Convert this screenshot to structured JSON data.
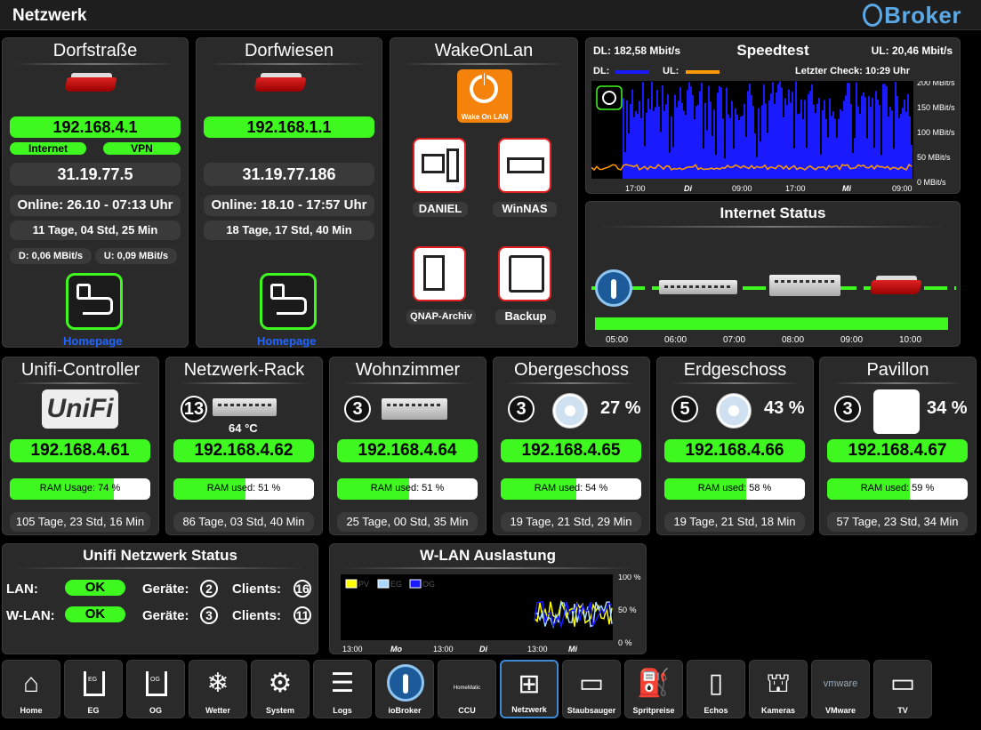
{
  "page_title": "Netzwerk",
  "logo": "Broker",
  "dorf1": {
    "title": "Dorfstraße",
    "ip": "192.168.4.1",
    "badge1": "Internet",
    "badge2": "VPN",
    "ext_ip": "31.19.77.5",
    "online": "Online: 26.10 - 07:13 Uhr",
    "uptime": "11 Tage, 04 Std, 25 Min",
    "down": "D: 0,06 MBit/s",
    "up": "U: 0,09 MBit/s",
    "home": "Homepage"
  },
  "dorf2": {
    "title": "Dorfwiesen",
    "ip": "192.168.1.1",
    "ext_ip": "31.19.77.186",
    "online": "Online: 18.10 - 17:57 Uhr",
    "uptime": "18 Tage, 17 Std, 40 Min",
    "home": "Homepage"
  },
  "wol": {
    "title": "WakeOnLan",
    "logo_text": "Wake On LAN",
    "b1": "DANIEL",
    "b2": "WinNAS",
    "b3": "QNAP-Archiv",
    "b4": "Backup"
  },
  "speedtest": {
    "title": "Speedtest",
    "dl": "DL: 182,58 Mbit/s",
    "ul": "UL: 20,46 Mbit/s",
    "dl_leg": "DL:",
    "ul_leg": "UL:",
    "check": "Letzter Check: 10:29 Uhr",
    "y_ticks": [
      "200 MBit/s",
      "150 MBit/s",
      "100 MBit/s",
      "50 MBit/s",
      "0 MBit/s"
    ],
    "x_ticks": [
      "17:00",
      "Di",
      "09:00",
      "17:00",
      "Mi",
      "09:00"
    ],
    "colors": {
      "dl": "#1a1aff",
      "ul": "#ff9900"
    }
  },
  "inet": {
    "title": "Internet Status",
    "times": [
      "05:00",
      "06:00",
      "07:00",
      "08:00",
      "09:00",
      "10:00"
    ]
  },
  "devices": [
    {
      "title": "Unifi-Controller",
      "logo": "UniFi",
      "ip": "192.168.4.61",
      "ram": "RAM Usage: 74 %",
      "ram_pct": 74,
      "uptime": "105 Tage, 23 Std, 16 Min"
    },
    {
      "title": "Netzwerk-Rack",
      "count": "13",
      "temp": "64 °C",
      "ip": "192.168.4.62",
      "ram": "RAM used: 51 %",
      "ram_pct": 51,
      "uptime": "86 Tage, 03 Std, 40 Min"
    },
    {
      "title": "Wohnzimmer",
      "count": "3",
      "ip": "192.168.4.64",
      "ram": "RAM used: 51 %",
      "ram_pct": 51,
      "uptime": "25 Tage, 00 Std, 35 Min"
    },
    {
      "title": "Obergeschoss",
      "count": "3",
      "pct": "27 %",
      "ip": "192.168.4.65",
      "ram": "RAM used: 54 %",
      "ram_pct": 54,
      "uptime": "19 Tage, 21 Std, 29 Min"
    },
    {
      "title": "Erdgeschoss",
      "count": "5",
      "pct": "43 %",
      "ip": "192.168.4.66",
      "ram": "RAM used: 58 %",
      "ram_pct": 58,
      "uptime": "19 Tage, 21 Std, 18 Min"
    },
    {
      "title": "Pavillon",
      "count": "3",
      "pct": "34 %",
      "ip": "192.168.4.67",
      "ram": "RAM used: 59 %",
      "ram_pct": 59,
      "uptime": "57 Tage, 23 Std, 34 Min"
    }
  ],
  "unifi_status": {
    "title": "Unifi Netzwerk Status",
    "lan": "LAN:",
    "wlan": "W-LAN:",
    "ok": "OK",
    "geraete": "Geräte:",
    "clients": "Clients:",
    "lan_geraete": "2",
    "lan_clients": "16",
    "wlan_geraete": "3",
    "wlan_clients": "11"
  },
  "wlan_load": {
    "title": "W-LAN Auslastung",
    "legend": [
      "PV",
      "EG",
      "OG"
    ],
    "legend_colors": [
      "#ffff00",
      "#a8d8ff",
      "#1a1aff"
    ],
    "y_ticks": [
      "100 %",
      "50 %",
      "0 %"
    ],
    "x_ticks": [
      "13:00",
      "Mo",
      "13:00",
      "Di",
      "13:00",
      "Mi"
    ]
  },
  "nav": [
    "Home",
    "EG",
    "OG",
    "Wetter",
    "System",
    "Logs",
    "ioBroker",
    "CCU",
    "Netzwerk",
    "Staubsauger",
    "Spritpreise",
    "Echos",
    "Kameras",
    "VMware",
    "TV"
  ],
  "nav_icon_text": {
    "eg": "EG",
    "og": "OG",
    "ccu": "HomeMatic",
    "vmware": "vmware"
  }
}
